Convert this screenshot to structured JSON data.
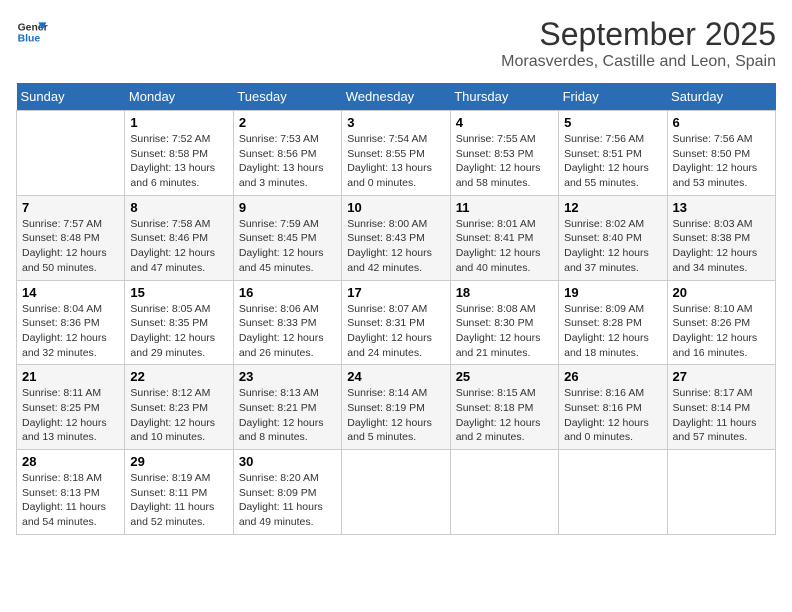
{
  "header": {
    "logo_line1": "General",
    "logo_line2": "Blue",
    "month": "September 2025",
    "location": "Morasverdes, Castille and Leon, Spain"
  },
  "weekdays": [
    "Sunday",
    "Monday",
    "Tuesday",
    "Wednesday",
    "Thursday",
    "Friday",
    "Saturday"
  ],
  "weeks": [
    [
      {
        "day": "",
        "sunrise": "",
        "sunset": "",
        "daylight": ""
      },
      {
        "day": "1",
        "sunrise": "Sunrise: 7:52 AM",
        "sunset": "Sunset: 8:58 PM",
        "daylight": "Daylight: 13 hours and 6 minutes."
      },
      {
        "day": "2",
        "sunrise": "Sunrise: 7:53 AM",
        "sunset": "Sunset: 8:56 PM",
        "daylight": "Daylight: 13 hours and 3 minutes."
      },
      {
        "day": "3",
        "sunrise": "Sunrise: 7:54 AM",
        "sunset": "Sunset: 8:55 PM",
        "daylight": "Daylight: 13 hours and 0 minutes."
      },
      {
        "day": "4",
        "sunrise": "Sunrise: 7:55 AM",
        "sunset": "Sunset: 8:53 PM",
        "daylight": "Daylight: 12 hours and 58 minutes."
      },
      {
        "day": "5",
        "sunrise": "Sunrise: 7:56 AM",
        "sunset": "Sunset: 8:51 PM",
        "daylight": "Daylight: 12 hours and 55 minutes."
      },
      {
        "day": "6",
        "sunrise": "Sunrise: 7:56 AM",
        "sunset": "Sunset: 8:50 PM",
        "daylight": "Daylight: 12 hours and 53 minutes."
      }
    ],
    [
      {
        "day": "7",
        "sunrise": "Sunrise: 7:57 AM",
        "sunset": "Sunset: 8:48 PM",
        "daylight": "Daylight: 12 hours and 50 minutes."
      },
      {
        "day": "8",
        "sunrise": "Sunrise: 7:58 AM",
        "sunset": "Sunset: 8:46 PM",
        "daylight": "Daylight: 12 hours and 47 minutes."
      },
      {
        "day": "9",
        "sunrise": "Sunrise: 7:59 AM",
        "sunset": "Sunset: 8:45 PM",
        "daylight": "Daylight: 12 hours and 45 minutes."
      },
      {
        "day": "10",
        "sunrise": "Sunrise: 8:00 AM",
        "sunset": "Sunset: 8:43 PM",
        "daylight": "Daylight: 12 hours and 42 minutes."
      },
      {
        "day": "11",
        "sunrise": "Sunrise: 8:01 AM",
        "sunset": "Sunset: 8:41 PM",
        "daylight": "Daylight: 12 hours and 40 minutes."
      },
      {
        "day": "12",
        "sunrise": "Sunrise: 8:02 AM",
        "sunset": "Sunset: 8:40 PM",
        "daylight": "Daylight: 12 hours and 37 minutes."
      },
      {
        "day": "13",
        "sunrise": "Sunrise: 8:03 AM",
        "sunset": "Sunset: 8:38 PM",
        "daylight": "Daylight: 12 hours and 34 minutes."
      }
    ],
    [
      {
        "day": "14",
        "sunrise": "Sunrise: 8:04 AM",
        "sunset": "Sunset: 8:36 PM",
        "daylight": "Daylight: 12 hours and 32 minutes."
      },
      {
        "day": "15",
        "sunrise": "Sunrise: 8:05 AM",
        "sunset": "Sunset: 8:35 PM",
        "daylight": "Daylight: 12 hours and 29 minutes."
      },
      {
        "day": "16",
        "sunrise": "Sunrise: 8:06 AM",
        "sunset": "Sunset: 8:33 PM",
        "daylight": "Daylight: 12 hours and 26 minutes."
      },
      {
        "day": "17",
        "sunrise": "Sunrise: 8:07 AM",
        "sunset": "Sunset: 8:31 PM",
        "daylight": "Daylight: 12 hours and 24 minutes."
      },
      {
        "day": "18",
        "sunrise": "Sunrise: 8:08 AM",
        "sunset": "Sunset: 8:30 PM",
        "daylight": "Daylight: 12 hours and 21 minutes."
      },
      {
        "day": "19",
        "sunrise": "Sunrise: 8:09 AM",
        "sunset": "Sunset: 8:28 PM",
        "daylight": "Daylight: 12 hours and 18 minutes."
      },
      {
        "day": "20",
        "sunrise": "Sunrise: 8:10 AM",
        "sunset": "Sunset: 8:26 PM",
        "daylight": "Daylight: 12 hours and 16 minutes."
      }
    ],
    [
      {
        "day": "21",
        "sunrise": "Sunrise: 8:11 AM",
        "sunset": "Sunset: 8:25 PM",
        "daylight": "Daylight: 12 hours and 13 minutes."
      },
      {
        "day": "22",
        "sunrise": "Sunrise: 8:12 AM",
        "sunset": "Sunset: 8:23 PM",
        "daylight": "Daylight: 12 hours and 10 minutes."
      },
      {
        "day": "23",
        "sunrise": "Sunrise: 8:13 AM",
        "sunset": "Sunset: 8:21 PM",
        "daylight": "Daylight: 12 hours and 8 minutes."
      },
      {
        "day": "24",
        "sunrise": "Sunrise: 8:14 AM",
        "sunset": "Sunset: 8:19 PM",
        "daylight": "Daylight: 12 hours and 5 minutes."
      },
      {
        "day": "25",
        "sunrise": "Sunrise: 8:15 AM",
        "sunset": "Sunset: 8:18 PM",
        "daylight": "Daylight: 12 hours and 2 minutes."
      },
      {
        "day": "26",
        "sunrise": "Sunrise: 8:16 AM",
        "sunset": "Sunset: 8:16 PM",
        "daylight": "Daylight: 12 hours and 0 minutes."
      },
      {
        "day": "27",
        "sunrise": "Sunrise: 8:17 AM",
        "sunset": "Sunset: 8:14 PM",
        "daylight": "Daylight: 11 hours and 57 minutes."
      }
    ],
    [
      {
        "day": "28",
        "sunrise": "Sunrise: 8:18 AM",
        "sunset": "Sunset: 8:13 PM",
        "daylight": "Daylight: 11 hours and 54 minutes."
      },
      {
        "day": "29",
        "sunrise": "Sunrise: 8:19 AM",
        "sunset": "Sunset: 8:11 PM",
        "daylight": "Daylight: 11 hours and 52 minutes."
      },
      {
        "day": "30",
        "sunrise": "Sunrise: 8:20 AM",
        "sunset": "Sunset: 8:09 PM",
        "daylight": "Daylight: 11 hours and 49 minutes."
      },
      {
        "day": "",
        "sunrise": "",
        "sunset": "",
        "daylight": ""
      },
      {
        "day": "",
        "sunrise": "",
        "sunset": "",
        "daylight": ""
      },
      {
        "day": "",
        "sunrise": "",
        "sunset": "",
        "daylight": ""
      },
      {
        "day": "",
        "sunrise": "",
        "sunset": "",
        "daylight": ""
      }
    ]
  ]
}
